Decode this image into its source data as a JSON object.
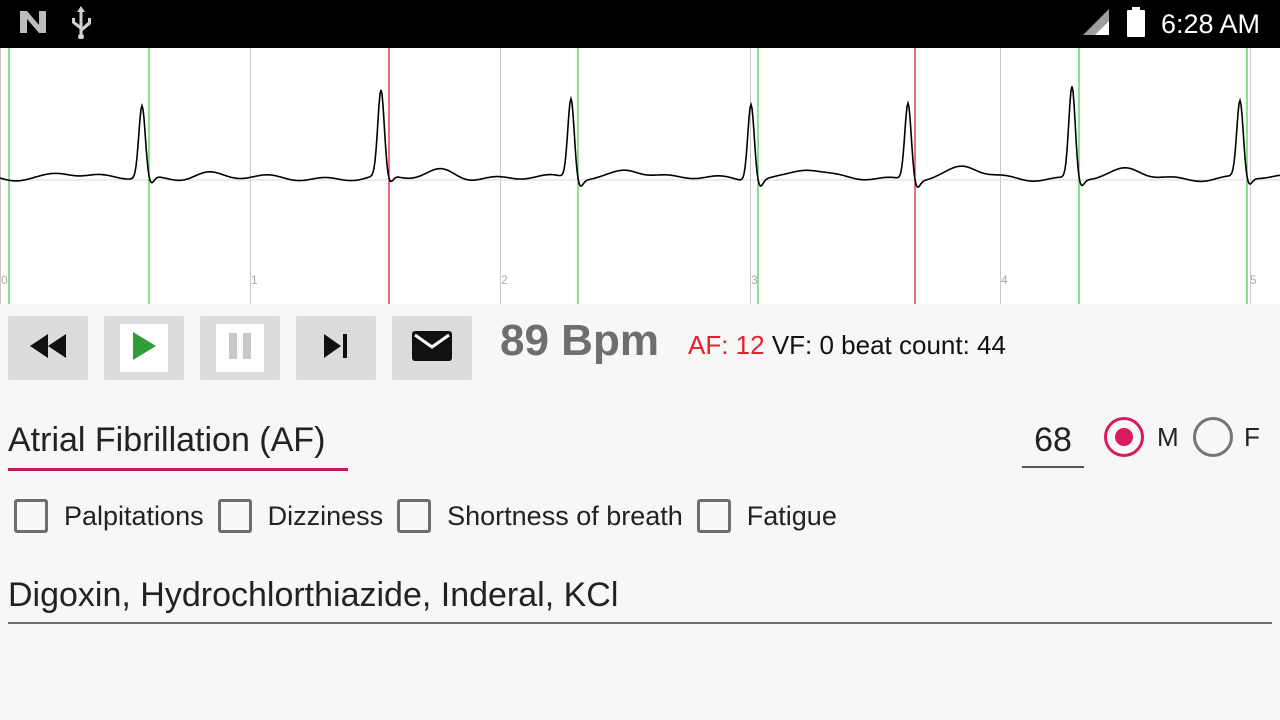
{
  "status_bar": {
    "time": "6:28 AM",
    "icons": [
      "n-logo-icon",
      "usb-icon",
      "signal-icon",
      "battery-icon"
    ]
  },
  "ecg": {
    "axis_labels": [
      "0",
      "1",
      "2",
      "3",
      "4",
      "5"
    ],
    "colors": {
      "normal_marker": "#4cd44c",
      "af_marker": "#e0203a",
      "grid": "#c8c8c8",
      "trace": "#000000"
    }
  },
  "toolbar": {
    "buttons": [
      "rewind-icon",
      "play-icon",
      "pause-icon",
      "skip-next-icon",
      "mail-icon"
    ]
  },
  "summary": {
    "bpm": "89 Bpm",
    "af": "AF: 12",
    "vf": " VF: 0",
    "beat_count": " beat count: 44"
  },
  "form": {
    "diagnosis": "Atrial Fibrillation (AF)",
    "age": "68",
    "sex_options": {
      "m": "M",
      "f": "F"
    },
    "sex_selected": "M",
    "symptoms": [
      {
        "label": "Palpitations",
        "checked": false
      },
      {
        "label": "Dizziness",
        "checked": false
      },
      {
        "label": "Shortness of breath",
        "checked": false
      },
      {
        "label": "Fatigue",
        "checked": false
      }
    ],
    "medications": "Digoxin, Hydrochlorthiazide, Inderal, KCl"
  },
  "colors": {
    "accent": "#d81b60",
    "af_text": "#e5202c"
  }
}
